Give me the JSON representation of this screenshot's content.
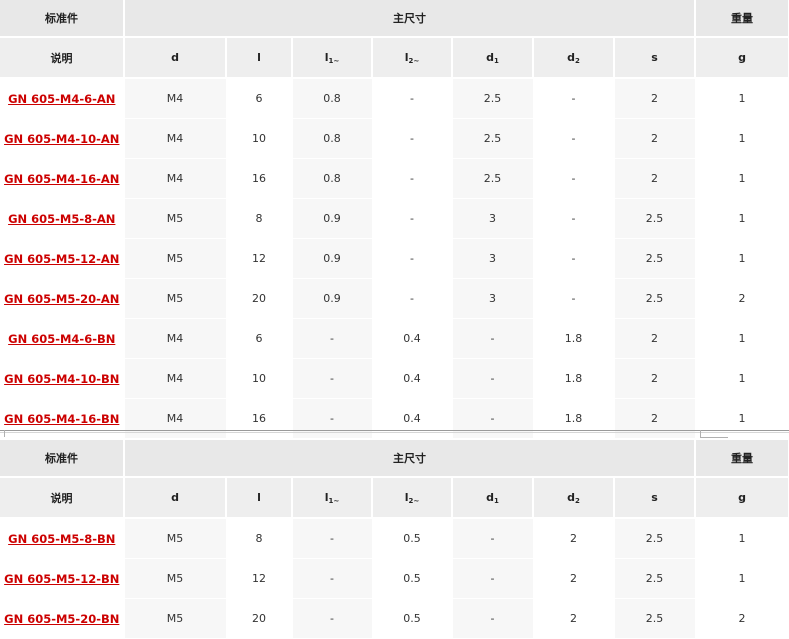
{
  "headers": {
    "standard": "标准件",
    "main_dims": "主尺寸",
    "weight": "重量",
    "desc": "说明",
    "d": "d",
    "l": "l",
    "l1": "l",
    "l1_sub": "1~",
    "l2": "l",
    "l2_sub": "2~",
    "d1": "d",
    "d1_sub": "1",
    "d2": "d",
    "d2_sub": "2",
    "s": "s",
    "g": "g"
  },
  "table1": [
    {
      "part": "GN 605-M4-6-AN",
      "d": "M4",
      "l": "6",
      "l1": "0.8",
      "l2": "-",
      "d1": "2.5",
      "d2": "-",
      "s": "2",
      "g": "1"
    },
    {
      "part": "GN 605-M4-10-AN",
      "d": "M4",
      "l": "10",
      "l1": "0.8",
      "l2": "-",
      "d1": "2.5",
      "d2": "-",
      "s": "2",
      "g": "1"
    },
    {
      "part": "GN 605-M4-16-AN",
      "d": "M4",
      "l": "16",
      "l1": "0.8",
      "l2": "-",
      "d1": "2.5",
      "d2": "-",
      "s": "2",
      "g": "1"
    },
    {
      "part": "GN 605-M5-8-AN",
      "d": "M5",
      "l": "8",
      "l1": "0.9",
      "l2": "-",
      "d1": "3",
      "d2": "-",
      "s": "2.5",
      "g": "1"
    },
    {
      "part": "GN 605-M5-12-AN",
      "d": "M5",
      "l": "12",
      "l1": "0.9",
      "l2": "-",
      "d1": "3",
      "d2": "-",
      "s": "2.5",
      "g": "1"
    },
    {
      "part": "GN 605-M5-20-AN",
      "d": "M5",
      "l": "20",
      "l1": "0.9",
      "l2": "-",
      "d1": "3",
      "d2": "-",
      "s": "2.5",
      "g": "2"
    },
    {
      "part": "GN 605-M4-6-BN",
      "d": "M4",
      "l": "6",
      "l1": "-",
      "l2": "0.4",
      "d1": "-",
      "d2": "1.8",
      "s": "2",
      "g": "1"
    },
    {
      "part": "GN 605-M4-10-BN",
      "d": "M4",
      "l": "10",
      "l1": "-",
      "l2": "0.4",
      "d1": "-",
      "d2": "1.8",
      "s": "2",
      "g": "1"
    },
    {
      "part": "GN 605-M4-16-BN",
      "d": "M4",
      "l": "16",
      "l1": "-",
      "l2": "0.4",
      "d1": "-",
      "d2": "1.8",
      "s": "2",
      "g": "1"
    }
  ],
  "table2": [
    {
      "part": "GN 605-M5-8-BN",
      "d": "M5",
      "l": "8",
      "l1": "-",
      "l2": "0.5",
      "d1": "-",
      "d2": "2",
      "s": "2.5",
      "g": "1"
    },
    {
      "part": "GN 605-M5-12-BN",
      "d": "M5",
      "l": "12",
      "l1": "-",
      "l2": "0.5",
      "d1": "-",
      "d2": "2",
      "s": "2.5",
      "g": "1"
    },
    {
      "part": "GN 605-M5-20-BN",
      "d": "M5",
      "l": "20",
      "l1": "-",
      "l2": "0.5",
      "d1": "-",
      "d2": "2",
      "s": "2.5",
      "g": "2"
    }
  ],
  "colors": {
    "link": "#cc0000",
    "header_bg": "#e8e8e8",
    "zebra": "#f7f7f7"
  }
}
